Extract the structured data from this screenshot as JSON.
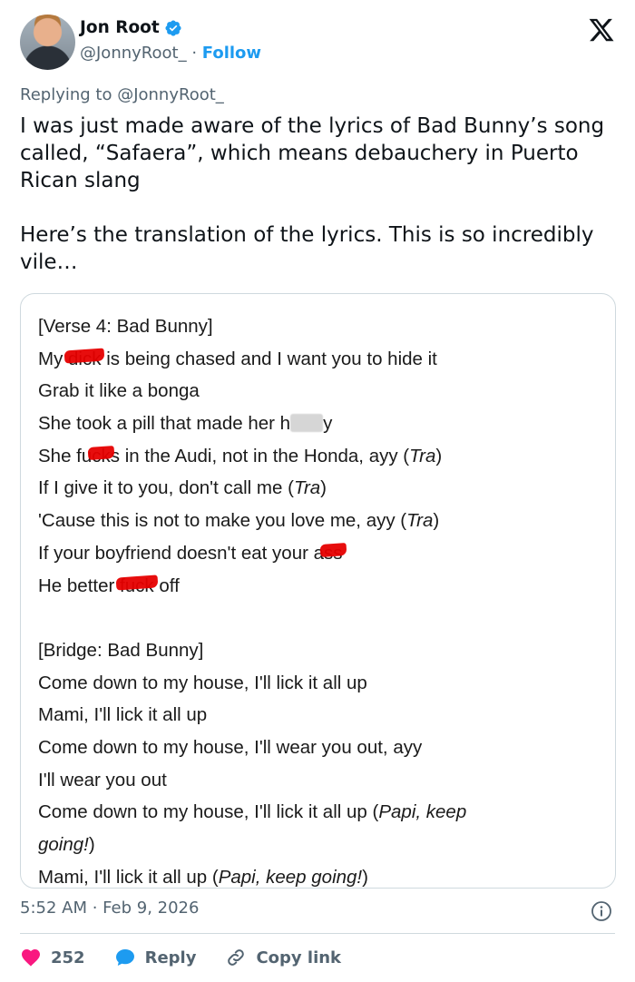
{
  "user": {
    "name": "Jon Root",
    "handle": "@JonnyRoot_",
    "separator": "·",
    "follow_label": "Follow"
  },
  "tweet": {
    "replying_to": "Replying to @JonnyRoot_",
    "text": "I was just made aware of the lyrics of Bad Bunny’s song called, “Safaera”, which means debauchery in Puerto Rican slang\n\nHere’s the translation of the lyrics. This is so incredibly vile…"
  },
  "lyrics": {
    "verse_header": "[Verse 4: Bad Bunny]",
    "l1_a": "My ",
    "l1_censored": "dick",
    "l1_b": " is being chased and I want you to hide it",
    "l2": "Grab it like a bonga",
    "l3_a": "She took a pill that made her h",
    "l3_b": "y",
    "l4_a": "She fu",
    "l4_censored": "ck",
    "l4_b": "s in the Audi, not in the Honda, ayy (",
    "l4_tra": "Tra",
    "l4_c": ")",
    "l5_a": "If I give it to you, don't call me (",
    "l5_tra": "Tra",
    "l5_c": ")",
    "l6_a": "'Cause this is not to make you love me, ayy (",
    "l6_tra": "Tra",
    "l6_c": ")",
    "l7_a": "If your boyfriend doesn't eat your a",
    "l7_censored": "ss",
    "l8_a": "He better ",
    "l8_censored": "fuck",
    "l8_b": " off",
    "bridge_header": "[Bridge: Bad Bunny]",
    "b1": "Come down to my house, I'll lick it all up",
    "b2": "Mami, I'll lick it all up",
    "b3": "Come down to my house, I'll wear you out, ayy",
    "b4": "I'll wear you out",
    "b5_a": "Come down to my house, I'll lick it all up (",
    "b5_i": "Papi, keep",
    "b6_i": "going!",
    "b6_c": ")",
    "b7_a": "Mami, I'll lick it all up (",
    "b7_i": "Papi, keep going!",
    "b7_c": ")"
  },
  "meta": {
    "timestamp": "5:52 AM · Feb 9, 2026"
  },
  "actions": {
    "likes": "252",
    "reply_label": "Reply",
    "copy_label": "Copy link"
  },
  "colors": {
    "accent": "#1d9bf0",
    "heart": "#f91880",
    "secondary_text": "#536471",
    "censor_red": "#e60000"
  },
  "icons": [
    "verified-badge-icon",
    "x-logo-icon",
    "info-icon",
    "heart-icon",
    "reply-bubble-icon",
    "link-icon"
  ]
}
